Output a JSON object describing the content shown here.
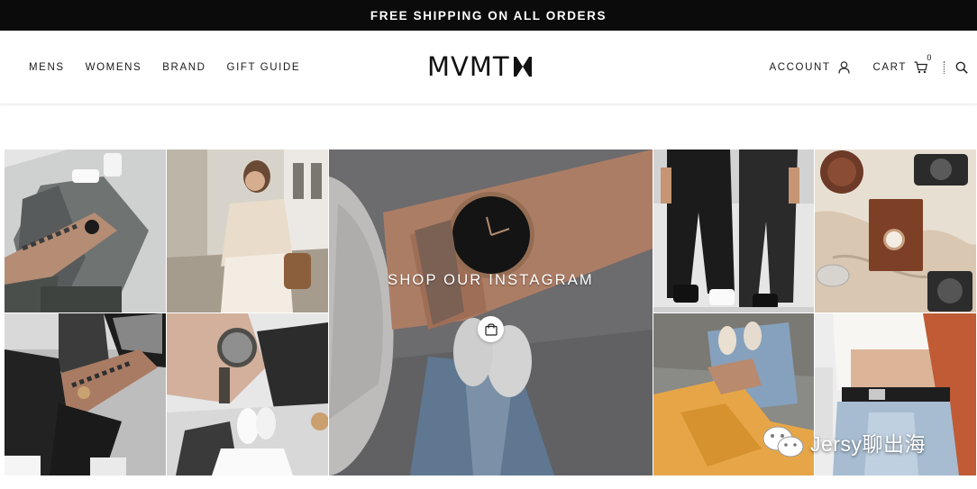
{
  "promo": {
    "text": "FREE SHIPPING ON ALL ORDERS"
  },
  "nav": {
    "left": [
      "MENS",
      "WOMENS",
      "BRAND",
      "GIFT GUIDE"
    ],
    "logo_text": "MVMT",
    "account_label": "ACCOUNT",
    "cart_label": "CART",
    "cart_count": "0"
  },
  "instagram": {
    "label": "SHOP OUR INSTAGRAM"
  },
  "watermark": {
    "text": "Jersy聊出海"
  },
  "colors": {
    "promo_bg": "#0b0b0b",
    "header_bg": "#ffffff",
    "text": "#111111"
  },
  "icons": [
    "person-icon",
    "cart-icon",
    "search-icon",
    "shopping-bag-icon",
    "wechat-icon"
  ]
}
